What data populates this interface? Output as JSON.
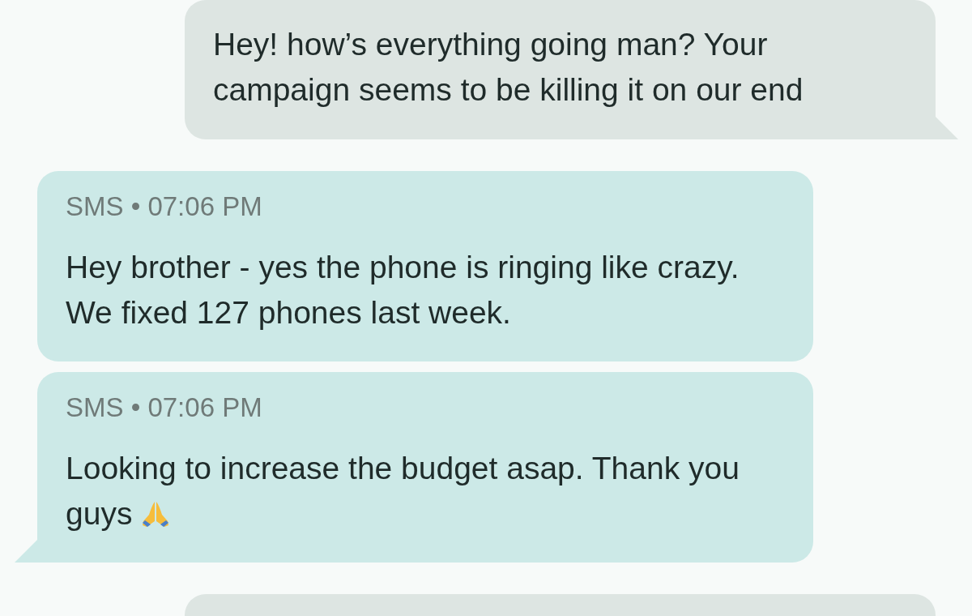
{
  "messages": [
    {
      "kind": "outgoing",
      "text": "Hey! how’s everything going man? Your campaign seems to be killing it on our end"
    },
    {
      "kind": "incoming",
      "meta": "SMS • 07:06 PM",
      "text": "Hey brother - yes the phone is ringing like crazy. We fixed 127 phones last week."
    },
    {
      "kind": "incoming",
      "meta": "SMS • 07:06 PM",
      "text": "Looking to increase the budget asap. Thank you guys",
      "trailing_icon": true
    },
    {
      "kind": "outgoing"
    }
  ]
}
